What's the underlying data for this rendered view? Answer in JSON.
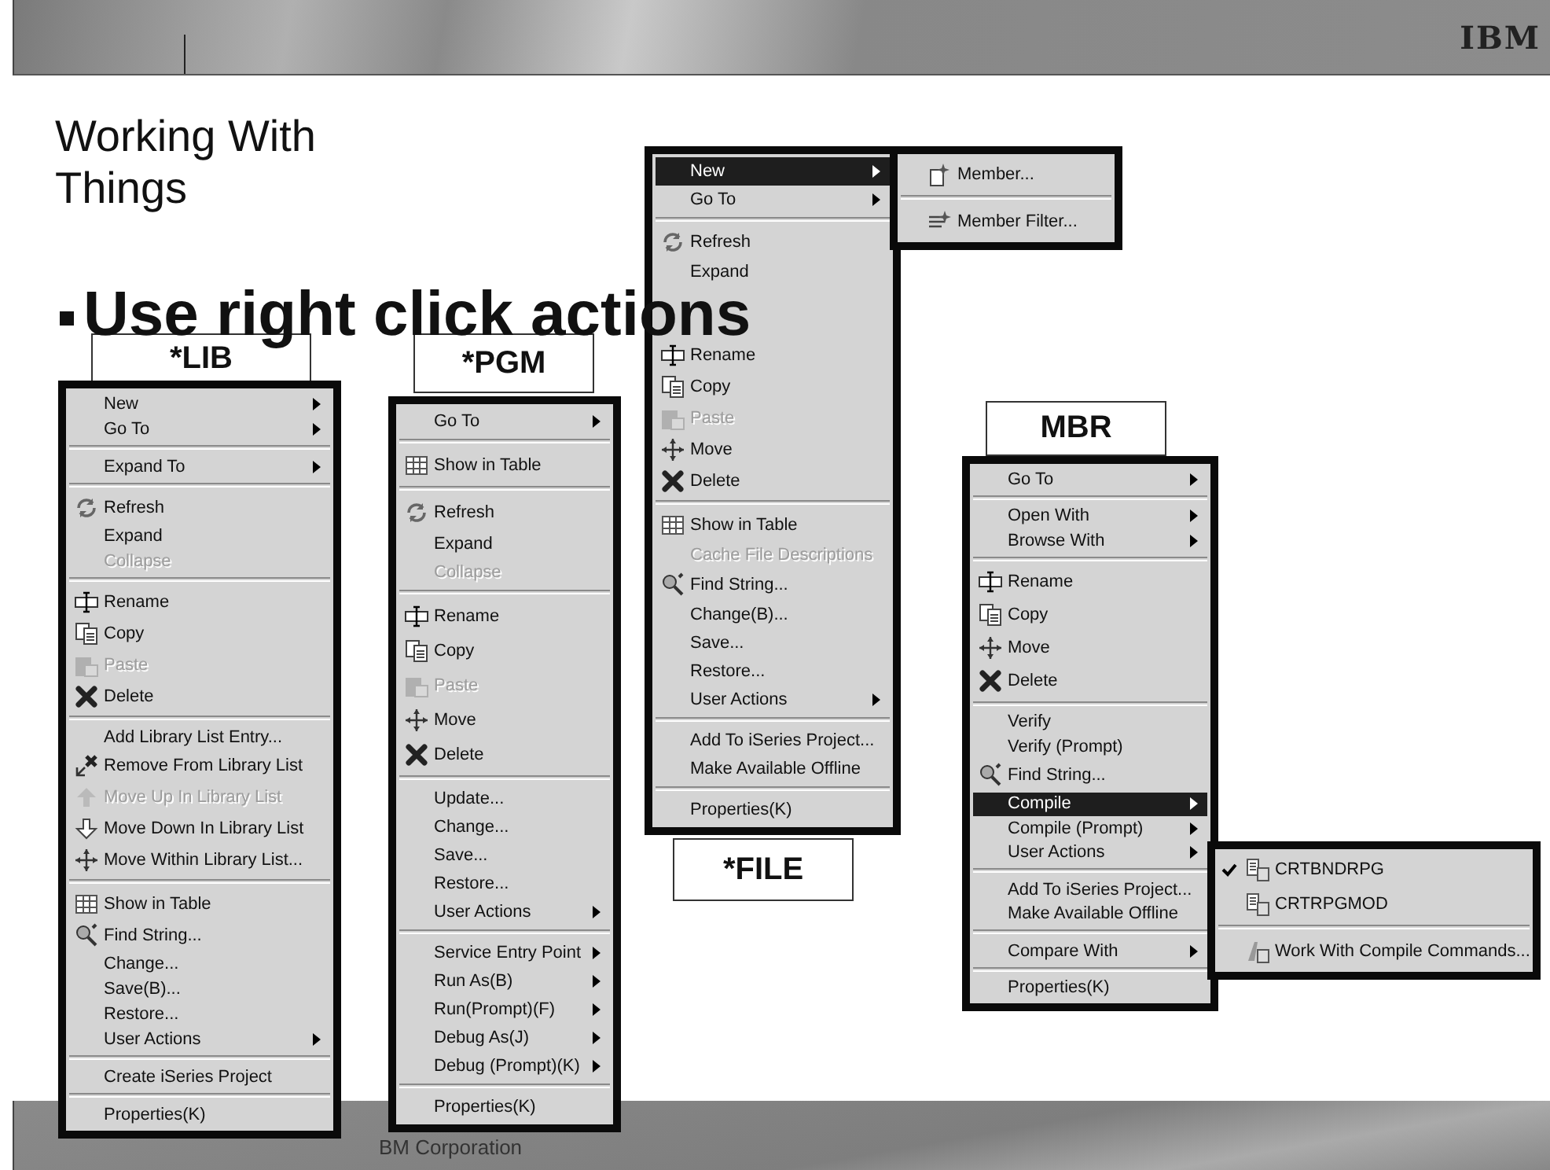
{
  "header": {
    "logo": "IBM"
  },
  "title": "Working With Things",
  "bullet": "Use right click actions",
  "footer": "BM Corporation",
  "menus": [
    {
      "label": "*LIB",
      "items": [
        {
          "kind": "item",
          "text": "New",
          "has_submenu": true,
          "selected": false,
          "disabled": false
        },
        {
          "kind": "item",
          "text": "Go To",
          "has_submenu": true,
          "selected": false,
          "disabled": false
        },
        {
          "kind": "separator"
        },
        {
          "kind": "item",
          "text": "Expand To",
          "has_submenu": true,
          "selected": false,
          "disabled": false
        },
        {
          "kind": "separator"
        },
        {
          "kind": "item",
          "text": "Refresh",
          "selected": false,
          "disabled": false
        },
        {
          "kind": "item",
          "text": "Expand",
          "selected": false,
          "disabled": false
        },
        {
          "kind": "item",
          "text": "Collapse",
          "selected": false,
          "disabled": true
        },
        {
          "kind": "separator"
        },
        {
          "kind": "item",
          "text": "Rename",
          "selected": false,
          "disabled": false
        },
        {
          "kind": "item",
          "text": "Copy",
          "selected": false,
          "disabled": false
        },
        {
          "kind": "item",
          "text": "Paste",
          "selected": false,
          "disabled": true
        },
        {
          "kind": "item",
          "text": "Delete",
          "selected": false,
          "disabled": false
        },
        {
          "kind": "separator"
        },
        {
          "kind": "item",
          "text": "Add Library List Entry...",
          "selected": false,
          "disabled": false
        },
        {
          "kind": "item",
          "text": "Remove From Library List",
          "selected": false,
          "disabled": false
        },
        {
          "kind": "item",
          "text": "Move Up In Library List",
          "selected": false,
          "disabled": true
        },
        {
          "kind": "item",
          "text": "Move Down In Library List",
          "selected": false,
          "disabled": false
        },
        {
          "kind": "item",
          "text": "Move Within Library List...",
          "selected": false,
          "disabled": false
        },
        {
          "kind": "separator"
        },
        {
          "kind": "item",
          "text": "Show in Table",
          "selected": false,
          "disabled": false
        },
        {
          "kind": "item",
          "text": "Find String...",
          "selected": false,
          "disabled": false
        },
        {
          "kind": "item",
          "text": "Change...",
          "selected": false,
          "disabled": false
        },
        {
          "kind": "item",
          "text": "Save(B)...",
          "selected": false,
          "disabled": false
        },
        {
          "kind": "item",
          "text": "Restore...",
          "selected": false,
          "disabled": false
        },
        {
          "kind": "item",
          "text": "User Actions",
          "has_submenu": true,
          "selected": false,
          "disabled": false
        },
        {
          "kind": "separator"
        },
        {
          "kind": "item",
          "text": "Create iSeries Project",
          "selected": false,
          "disabled": false
        },
        {
          "kind": "separator"
        },
        {
          "kind": "item",
          "text": "Properties(K)",
          "selected": false,
          "disabled": false
        }
      ]
    },
    {
      "label": "*PGM",
      "items": [
        {
          "kind": "item",
          "text": "Go To",
          "has_submenu": true,
          "selected": false,
          "disabled": false
        },
        {
          "kind": "separator"
        },
        {
          "kind": "item",
          "text": "Show in Table",
          "selected": false,
          "disabled": false
        },
        {
          "kind": "separator"
        },
        {
          "kind": "item",
          "text": "Refresh",
          "selected": false,
          "disabled": false
        },
        {
          "kind": "item",
          "text": "Expand",
          "selected": false,
          "disabled": false
        },
        {
          "kind": "item",
          "text": "Collapse",
          "selected": false,
          "disabled": true
        },
        {
          "kind": "separator"
        },
        {
          "kind": "item",
          "text": "Rename",
          "selected": false,
          "disabled": false
        },
        {
          "kind": "item",
          "text": "Copy",
          "selected": false,
          "disabled": false
        },
        {
          "kind": "item",
          "text": "Paste",
          "selected": false,
          "disabled": true
        },
        {
          "kind": "item",
          "text": "Move",
          "selected": false,
          "disabled": false
        },
        {
          "kind": "item",
          "text": "Delete",
          "selected": false,
          "disabled": false
        },
        {
          "kind": "separator"
        },
        {
          "kind": "item",
          "text": "Update...",
          "selected": false,
          "disabled": false
        },
        {
          "kind": "item",
          "text": "Change...",
          "selected": false,
          "disabled": false
        },
        {
          "kind": "item",
          "text": "Save...",
          "selected": false,
          "disabled": false
        },
        {
          "kind": "item",
          "text": "Restore...",
          "selected": false,
          "disabled": false
        },
        {
          "kind": "item",
          "text": "User Actions",
          "has_submenu": true,
          "selected": false,
          "disabled": false
        },
        {
          "kind": "separator"
        },
        {
          "kind": "item",
          "text": "Service Entry Point",
          "has_submenu": true,
          "selected": false,
          "disabled": false
        },
        {
          "kind": "item",
          "text": "Run As(B)",
          "has_submenu": true,
          "selected": false,
          "disabled": false
        },
        {
          "kind": "item",
          "text": "Run(Prompt)(F)",
          "has_submenu": true,
          "selected": false,
          "disabled": false
        },
        {
          "kind": "item",
          "text": "Debug As(J)",
          "has_submenu": true,
          "selected": false,
          "disabled": false
        },
        {
          "kind": "item",
          "text": "Debug (Prompt)(K)",
          "has_submenu": true,
          "selected": false,
          "disabled": false
        },
        {
          "kind": "separator"
        },
        {
          "kind": "item",
          "text": "Properties(K)",
          "selected": false,
          "disabled": false
        }
      ]
    },
    {
      "label": "*FILE",
      "items": [
        {
          "kind": "item",
          "text": "New",
          "has_submenu": true,
          "selected": true,
          "disabled": false
        },
        {
          "kind": "item",
          "text": "Go To",
          "has_submenu": true,
          "selected": false,
          "disabled": false
        },
        {
          "kind": "separator"
        },
        {
          "kind": "item",
          "text": "Refresh",
          "selected": false,
          "disabled": false
        },
        {
          "kind": "item",
          "text": "Expand",
          "selected": false,
          "disabled": false
        },
        {
          "kind": "covered"
        },
        {
          "kind": "item",
          "text": "Rename",
          "selected": false,
          "disabled": false
        },
        {
          "kind": "item",
          "text": "Copy",
          "selected": false,
          "disabled": false
        },
        {
          "kind": "item",
          "text": "Paste",
          "selected": false,
          "disabled": true
        },
        {
          "kind": "item",
          "text": "Move",
          "selected": false,
          "disabled": false
        },
        {
          "kind": "item",
          "text": "Delete",
          "selected": false,
          "disabled": false
        },
        {
          "kind": "separator"
        },
        {
          "kind": "item",
          "text": "Show in Table",
          "selected": false,
          "disabled": false
        },
        {
          "kind": "item",
          "text": "Cache File Descriptions",
          "selected": false,
          "disabled": true
        },
        {
          "kind": "item",
          "text": "Find String...",
          "selected": false,
          "disabled": false
        },
        {
          "kind": "item",
          "text": "Change(B)...",
          "selected": false,
          "disabled": false
        },
        {
          "kind": "item",
          "text": "Save...",
          "selected": false,
          "disabled": false
        },
        {
          "kind": "item",
          "text": "Restore...",
          "selected": false,
          "disabled": false
        },
        {
          "kind": "item",
          "text": "User Actions",
          "has_submenu": true,
          "selected": false,
          "disabled": false
        },
        {
          "kind": "separator"
        },
        {
          "kind": "item",
          "text": "Add To iSeries Project...",
          "selected": false,
          "disabled": false
        },
        {
          "kind": "item",
          "text": "Make Available Offline",
          "selected": false,
          "disabled": false
        },
        {
          "kind": "separator"
        },
        {
          "kind": "item",
          "text": "Properties(K)",
          "selected": false,
          "disabled": false
        }
      ],
      "open_submenu": [
        {
          "kind": "item",
          "text": "Member...",
          "checked": false
        },
        {
          "kind": "separator"
        },
        {
          "kind": "item",
          "text": "Member Filter...",
          "checked": false
        }
      ]
    },
    {
      "label": "MBR",
      "items": [
        {
          "kind": "item",
          "text": "Go To",
          "has_submenu": true,
          "selected": false,
          "disabled": false
        },
        {
          "kind": "separator"
        },
        {
          "kind": "item",
          "text": "Open With",
          "has_submenu": true,
          "selected": false,
          "disabled": false
        },
        {
          "kind": "item",
          "text": "Browse With",
          "has_submenu": true,
          "selected": false,
          "disabled": false
        },
        {
          "kind": "separator"
        },
        {
          "kind": "item",
          "text": "Rename",
          "selected": false,
          "disabled": false
        },
        {
          "kind": "item",
          "text": "Copy",
          "selected": false,
          "disabled": false
        },
        {
          "kind": "item",
          "text": "Move",
          "selected": false,
          "disabled": false
        },
        {
          "kind": "item",
          "text": "Delete",
          "selected": false,
          "disabled": false
        },
        {
          "kind": "separator"
        },
        {
          "kind": "item",
          "text": "Verify",
          "selected": false,
          "disabled": false
        },
        {
          "kind": "item",
          "text": "Verify (Prompt)",
          "selected": false,
          "disabled": false
        },
        {
          "kind": "item",
          "text": "Find String...",
          "selected": false,
          "disabled": false
        },
        {
          "kind": "item",
          "text": "Compile",
          "has_submenu": true,
          "selected": true,
          "disabled": false
        },
        {
          "kind": "item",
          "text": "Compile (Prompt)",
          "has_submenu": true,
          "selected": false,
          "disabled": false
        },
        {
          "kind": "item",
          "text": "User Actions",
          "has_submenu": true,
          "selected": false,
          "disabled": false
        },
        {
          "kind": "separator"
        },
        {
          "kind": "item",
          "text": "Add To iSeries Project...",
          "selected": false,
          "disabled": false
        },
        {
          "kind": "item",
          "text": "Make Available Offline",
          "selected": false,
          "disabled": false
        },
        {
          "kind": "separator"
        },
        {
          "kind": "item",
          "text": "Compare With",
          "has_submenu": true,
          "selected": false,
          "disabled": false
        },
        {
          "kind": "separator"
        },
        {
          "kind": "item",
          "text": "Properties(K)",
          "selected": false,
          "disabled": false
        }
      ],
      "open_submenu": [
        {
          "kind": "item",
          "text": "CRTBNDRPG",
          "checked": true
        },
        {
          "kind": "item",
          "text": "CRTRPGMOD",
          "checked": false
        },
        {
          "kind": "separator"
        },
        {
          "kind": "item",
          "text": "Work With Compile Commands...",
          "checked": false
        }
      ]
    }
  ]
}
